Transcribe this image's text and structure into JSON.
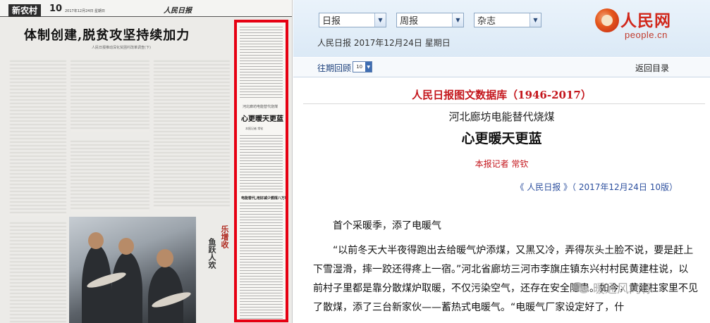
{
  "newspaper": {
    "section_tag": "新农村",
    "page_number": "10",
    "page_date": "2017年12月24日 星期日",
    "masthead": "人民日报",
    "headline": "体制创建,脱贫攻坚持续加力",
    "subheadline": "人民日报推动深化贫困村改革调查(下)",
    "side_text_1": "鱼跃人欢",
    "side_text_2": "乐增收",
    "article_kicker": "河北廊坊电能替代烧煤",
    "article_title": "心更暖天更蓝",
    "article_byline": "本报记者 常钦",
    "article_subhead": "电能替代,用好减少燃煤八万吨"
  },
  "header": {
    "selects": [
      {
        "label": "日报"
      },
      {
        "label": "周报"
      },
      {
        "label": "杂志"
      }
    ],
    "date_line": "人民日报 2017年12月24日 星期日",
    "logo_cn": "人民网",
    "logo_en": "people.cn"
  },
  "subbar": {
    "archive_label": "往期回顾",
    "archive_value": "10",
    "back_label": "返回目录"
  },
  "article": {
    "database_title": "人民日报图文数据库（1946-2017）",
    "kicker": "河北廊坊电能替代烧煤",
    "title": "心更暖天更蓝",
    "byline": "本报记者 常钦",
    "source": "《 人民日报 》（ 2017年12月24日   10版）",
    "paragraph_1": "首个采暖季，添了电暖气",
    "paragraph_2": "“以前冬天大半夜得跑出去给暖气炉添煤，又黑又冷，弄得灰头土脸不说，要是赶上下雪湿滑，摔一跤还得疼上一宿。”河北省廊坊三河市李旗庄镇东兴村村民黄建柱说，以前村子里都是靠分散煤炉取暖，不仅污染空气，还存在安全隐患。如今，黄建柱家里不见了散煤，添了三台新家伙——蓄热式电暖气。“电暖气厂家设定好了，什"
  },
  "watermark": {
    "text": "暖通风向标"
  },
  "colors": {
    "highlight_border": "#e60012",
    "title_red": "#c4161c",
    "link_blue": "#2c4f9e",
    "header_bg": "#dbe9f6"
  }
}
